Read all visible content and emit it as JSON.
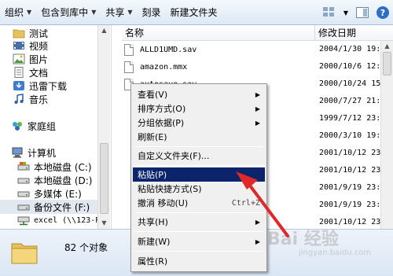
{
  "toolbar": {
    "organize": "组织",
    "include_in_library": "包含到库中",
    "share": "共享",
    "burn": "刻录",
    "new_folder": "新建文件夹"
  },
  "nav": {
    "items": [
      {
        "label": "测试",
        "icon": "folder-icon"
      },
      {
        "label": "视频",
        "icon": "video-library-icon"
      },
      {
        "label": "图片",
        "icon": "picture-library-icon"
      },
      {
        "label": "文档",
        "icon": "document-library-icon"
      },
      {
        "label": "迅雷下载",
        "icon": "download-library-icon"
      },
      {
        "label": "音乐",
        "icon": "music-library-icon"
      }
    ],
    "homegroup": "家庭组",
    "computer": "计算机",
    "drives": [
      {
        "label": "本地磁盘 (C:)",
        "icon": "drive-icon"
      },
      {
        "label": "本地磁盘 (D:)",
        "icon": "drive-icon"
      },
      {
        "label": "多媒体 (E:)",
        "icon": "drive-icon"
      },
      {
        "label": "备份文件 (F:)",
        "icon": "drive-icon"
      },
      {
        "label": "excel (\\\\123-P",
        "icon": "network-drive-icon"
      }
    ]
  },
  "list": {
    "col_name": "名称",
    "col_date": "修改日期",
    "files": [
      {
        "name": "ALLD1UMD.sav",
        "date": "2004/1/30 19:"
      },
      {
        "name": "amazon.mmx",
        "date": "2000/10/6 12:"
      },
      {
        "name": "autosave.sav",
        "date": "2000/10/24 15"
      }
    ],
    "dates": [
      "2000/7/27 21:",
      "1999/7/12 23:",
      "2000/3/10 19:",
      "2001/10/12 23",
      "2001/10/12 23",
      "2001/9/19 23:",
      "2001/9/19 23:",
      "2001/10/12 23",
      "2001/10/12 23"
    ]
  },
  "status": {
    "count": "82 个对象"
  },
  "context_menu": {
    "view": "查看(V)",
    "sort_by": "排序方式(O)",
    "group_by": "分组依据(P)",
    "refresh": "刷新(E)",
    "customize_folder": "自定义文件夹(F)...",
    "paste": "粘贴(P)",
    "paste_shortcut": "粘贴快捷方式(S)",
    "undo_move": "撤消 移动(U)",
    "undo_shortcut": "Ctrl+Z",
    "share": "共享(H)",
    "new": "新建(W)",
    "properties": "属性(R)"
  },
  "watermark": {
    "text": "Bai 经验",
    "sub": "jingyan.baidu.com"
  },
  "colors": {
    "highlight": "#0b246b",
    "arrow": "#e0272a"
  }
}
